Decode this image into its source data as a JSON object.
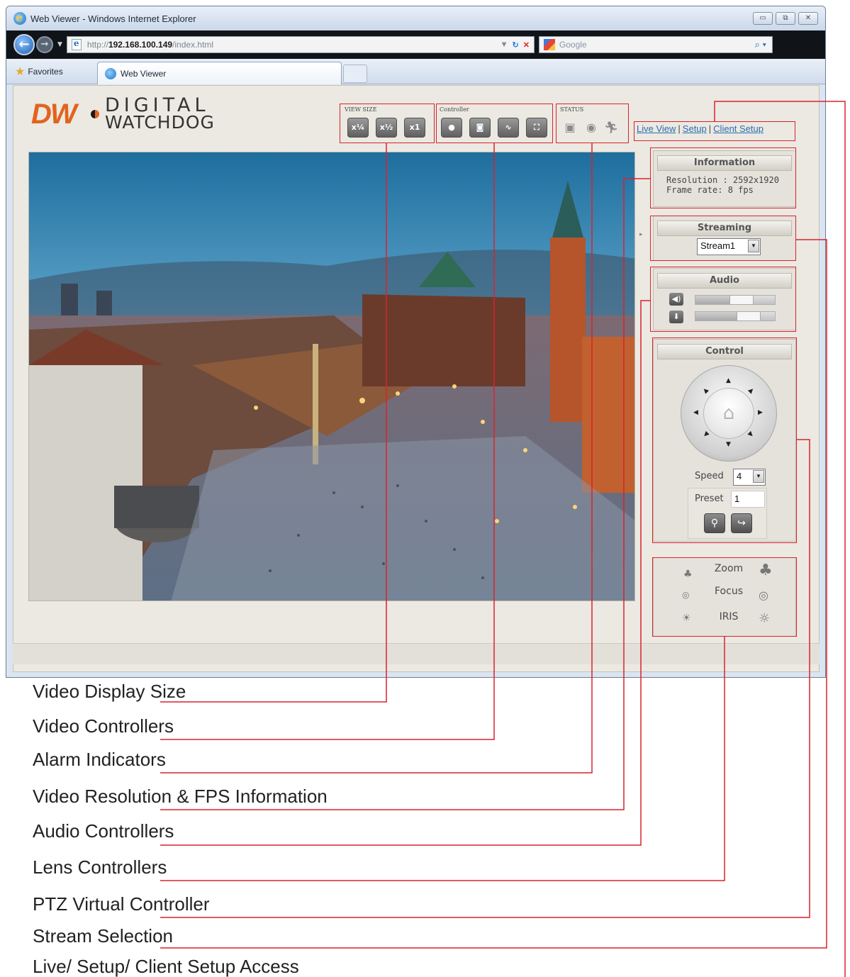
{
  "browser": {
    "title": "Web Viewer - Windows Internet Explorer",
    "url_prefix": "http://",
    "url_host": "192.168.100.149",
    "url_path": "/index.html",
    "search_placeholder": "Google",
    "favorites_label": "Favorites",
    "tab_label": "Web Viewer",
    "window_buttons": [
      "minimize-icon",
      "restore-icon",
      "close-icon"
    ]
  },
  "brand": {
    "mark": "DW",
    "line1": "DIGITAL",
    "line2": "WATCHDOG",
    "accent_color": "#e2631e"
  },
  "toolbar": {
    "view_size": {
      "label": "VIEW SIZE",
      "buttons": [
        "x¼",
        "x½",
        "x1"
      ]
    },
    "controller": {
      "label": "Controller",
      "buttons": [
        "record-icon",
        "snapshot-icon",
        "audio-wave-icon",
        "fullscreen-icon"
      ]
    },
    "status": {
      "label": "STATUS",
      "icons": [
        "sd-card-icon",
        "alarm-icon",
        "motion-icon"
      ]
    }
  },
  "nav": {
    "live_view": "Live View",
    "setup": "Setup",
    "client_setup": "Client Setup",
    "separator": "|"
  },
  "information": {
    "title": "Information",
    "resolution": "Resolution : 2592x1920",
    "frame_rate": "Frame rate: 8 fps"
  },
  "streaming": {
    "title": "Streaming",
    "selected": "Stream1"
  },
  "audio": {
    "title": "Audio",
    "speaker_level": 0.62,
    "mic_level": 0.74
  },
  "control": {
    "title": "Control",
    "speed_label": "Speed",
    "speed_value": "4",
    "preset_label": "Preset",
    "preset_value": "1"
  },
  "lens": {
    "zoom": "Zoom",
    "focus": "Focus",
    "iris": "IRIS"
  },
  "annotations": [
    "Video Display Size",
    "Video Controllers",
    "Alarm Indicators",
    "Video Resolution & FPS Information",
    "Audio Controllers",
    "Lens Controllers",
    "PTZ Virtual Controller",
    "Stream Selection",
    "Live/ Setup/ Client Setup Access"
  ],
  "annotation_color": "#d9232d"
}
